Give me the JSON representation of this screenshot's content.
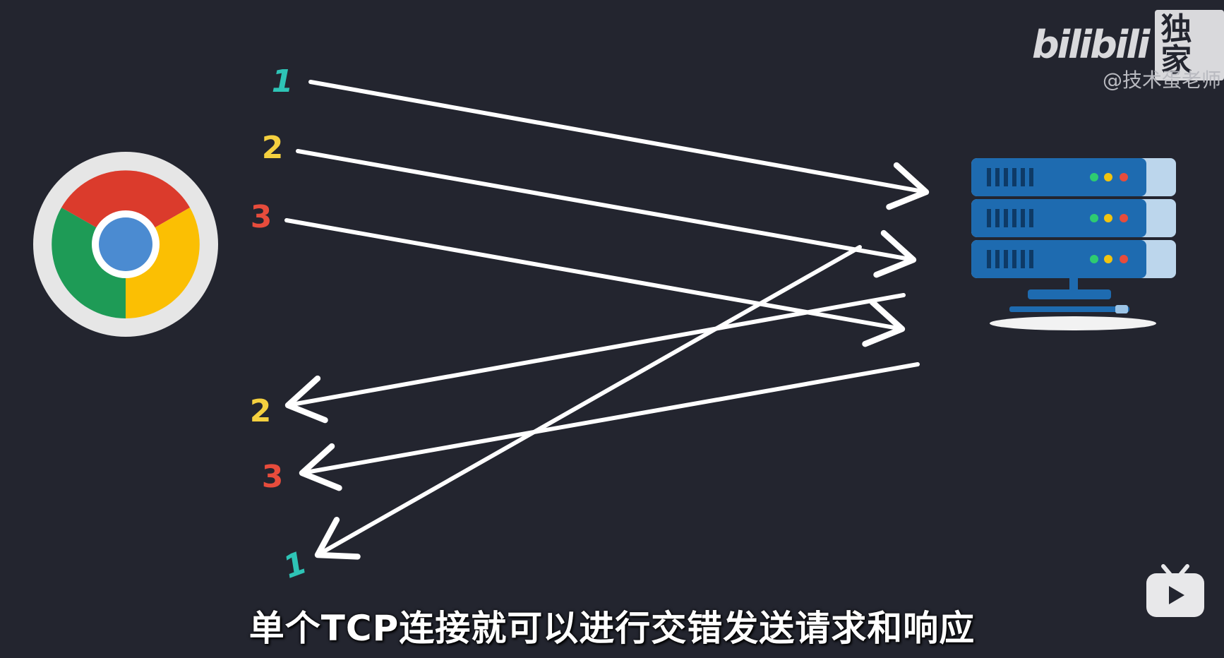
{
  "watermark": {
    "brand": "bilibili",
    "badge": "独家",
    "author": "@技术蛋老师"
  },
  "subtitle": "单个TCP连接就可以进行交错发送请求和响应",
  "requests": [
    {
      "label": "1",
      "color": "#2ec4b6"
    },
    {
      "label": "2",
      "color": "#f4d03f"
    },
    {
      "label": "3",
      "color": "#e74c3c"
    }
  ],
  "responses": [
    {
      "label": "2",
      "color": "#f4d03f"
    },
    {
      "label": "3",
      "color": "#e74c3c"
    },
    {
      "label": "1",
      "color": "#2ec4b6"
    }
  ],
  "icons": {
    "client": "chrome-browser-icon",
    "server": "server-rack-icon",
    "player": "bilibili-tv-icon"
  },
  "colors": {
    "background": "#23252f",
    "arrow": "#ffffff",
    "server_blue": "#1e6bb0",
    "led_green": "#2ecc71",
    "led_yellow": "#f1c40f",
    "led_red": "#e74c3c"
  }
}
